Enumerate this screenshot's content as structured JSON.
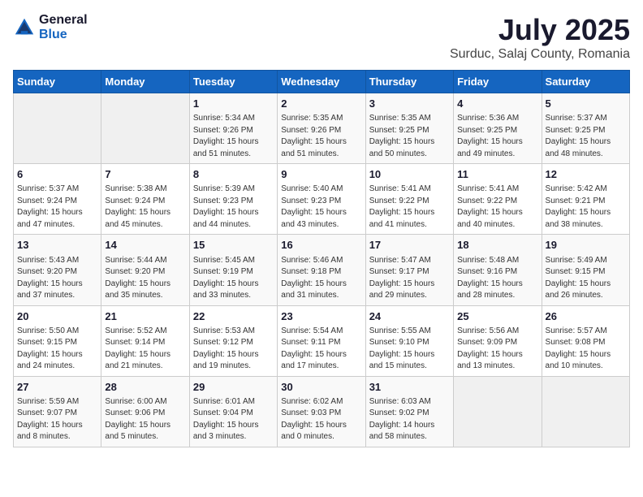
{
  "logo": {
    "line1": "General",
    "line2": "Blue"
  },
  "title": "July 2025",
  "subtitle": "Surduc, Salaj County, Romania",
  "days_header": [
    "Sunday",
    "Monday",
    "Tuesday",
    "Wednesday",
    "Thursday",
    "Friday",
    "Saturday"
  ],
  "weeks": [
    [
      {
        "day": "",
        "info": ""
      },
      {
        "day": "",
        "info": ""
      },
      {
        "day": "1",
        "info": "Sunrise: 5:34 AM\nSunset: 9:26 PM\nDaylight: 15 hours\nand 51 minutes."
      },
      {
        "day": "2",
        "info": "Sunrise: 5:35 AM\nSunset: 9:26 PM\nDaylight: 15 hours\nand 51 minutes."
      },
      {
        "day": "3",
        "info": "Sunrise: 5:35 AM\nSunset: 9:25 PM\nDaylight: 15 hours\nand 50 minutes."
      },
      {
        "day": "4",
        "info": "Sunrise: 5:36 AM\nSunset: 9:25 PM\nDaylight: 15 hours\nand 49 minutes."
      },
      {
        "day": "5",
        "info": "Sunrise: 5:37 AM\nSunset: 9:25 PM\nDaylight: 15 hours\nand 48 minutes."
      }
    ],
    [
      {
        "day": "6",
        "info": "Sunrise: 5:37 AM\nSunset: 9:24 PM\nDaylight: 15 hours\nand 47 minutes."
      },
      {
        "day": "7",
        "info": "Sunrise: 5:38 AM\nSunset: 9:24 PM\nDaylight: 15 hours\nand 45 minutes."
      },
      {
        "day": "8",
        "info": "Sunrise: 5:39 AM\nSunset: 9:23 PM\nDaylight: 15 hours\nand 44 minutes."
      },
      {
        "day": "9",
        "info": "Sunrise: 5:40 AM\nSunset: 9:23 PM\nDaylight: 15 hours\nand 43 minutes."
      },
      {
        "day": "10",
        "info": "Sunrise: 5:41 AM\nSunset: 9:22 PM\nDaylight: 15 hours\nand 41 minutes."
      },
      {
        "day": "11",
        "info": "Sunrise: 5:41 AM\nSunset: 9:22 PM\nDaylight: 15 hours\nand 40 minutes."
      },
      {
        "day": "12",
        "info": "Sunrise: 5:42 AM\nSunset: 9:21 PM\nDaylight: 15 hours\nand 38 minutes."
      }
    ],
    [
      {
        "day": "13",
        "info": "Sunrise: 5:43 AM\nSunset: 9:20 PM\nDaylight: 15 hours\nand 37 minutes."
      },
      {
        "day": "14",
        "info": "Sunrise: 5:44 AM\nSunset: 9:20 PM\nDaylight: 15 hours\nand 35 minutes."
      },
      {
        "day": "15",
        "info": "Sunrise: 5:45 AM\nSunset: 9:19 PM\nDaylight: 15 hours\nand 33 minutes."
      },
      {
        "day": "16",
        "info": "Sunrise: 5:46 AM\nSunset: 9:18 PM\nDaylight: 15 hours\nand 31 minutes."
      },
      {
        "day": "17",
        "info": "Sunrise: 5:47 AM\nSunset: 9:17 PM\nDaylight: 15 hours\nand 29 minutes."
      },
      {
        "day": "18",
        "info": "Sunrise: 5:48 AM\nSunset: 9:16 PM\nDaylight: 15 hours\nand 28 minutes."
      },
      {
        "day": "19",
        "info": "Sunrise: 5:49 AM\nSunset: 9:15 PM\nDaylight: 15 hours\nand 26 minutes."
      }
    ],
    [
      {
        "day": "20",
        "info": "Sunrise: 5:50 AM\nSunset: 9:15 PM\nDaylight: 15 hours\nand 24 minutes."
      },
      {
        "day": "21",
        "info": "Sunrise: 5:52 AM\nSunset: 9:14 PM\nDaylight: 15 hours\nand 21 minutes."
      },
      {
        "day": "22",
        "info": "Sunrise: 5:53 AM\nSunset: 9:12 PM\nDaylight: 15 hours\nand 19 minutes."
      },
      {
        "day": "23",
        "info": "Sunrise: 5:54 AM\nSunset: 9:11 PM\nDaylight: 15 hours\nand 17 minutes."
      },
      {
        "day": "24",
        "info": "Sunrise: 5:55 AM\nSunset: 9:10 PM\nDaylight: 15 hours\nand 15 minutes."
      },
      {
        "day": "25",
        "info": "Sunrise: 5:56 AM\nSunset: 9:09 PM\nDaylight: 15 hours\nand 13 minutes."
      },
      {
        "day": "26",
        "info": "Sunrise: 5:57 AM\nSunset: 9:08 PM\nDaylight: 15 hours\nand 10 minutes."
      }
    ],
    [
      {
        "day": "27",
        "info": "Sunrise: 5:59 AM\nSunset: 9:07 PM\nDaylight: 15 hours\nand 8 minutes."
      },
      {
        "day": "28",
        "info": "Sunrise: 6:00 AM\nSunset: 9:06 PM\nDaylight: 15 hours\nand 5 minutes."
      },
      {
        "day": "29",
        "info": "Sunrise: 6:01 AM\nSunset: 9:04 PM\nDaylight: 15 hours\nand 3 minutes."
      },
      {
        "day": "30",
        "info": "Sunrise: 6:02 AM\nSunset: 9:03 PM\nDaylight: 15 hours\nand 0 minutes."
      },
      {
        "day": "31",
        "info": "Sunrise: 6:03 AM\nSunset: 9:02 PM\nDaylight: 14 hours\nand 58 minutes."
      },
      {
        "day": "",
        "info": ""
      },
      {
        "day": "",
        "info": ""
      }
    ]
  ]
}
